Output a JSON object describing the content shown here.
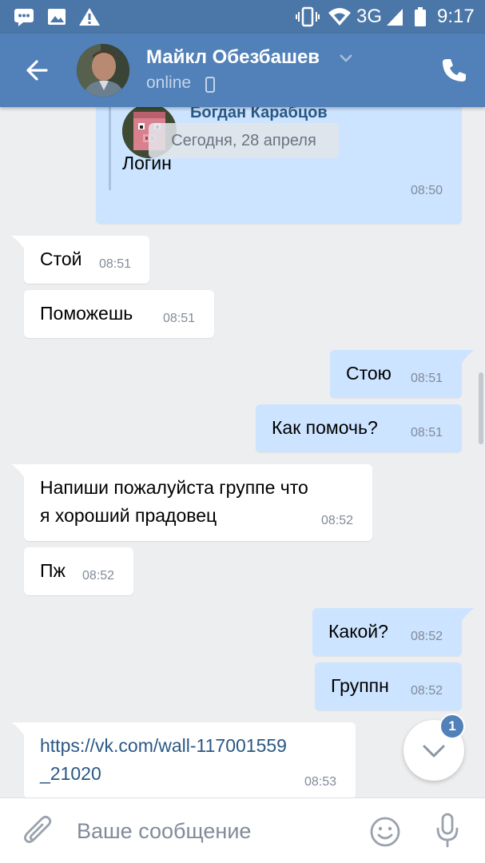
{
  "statusbar": {
    "network": "3G",
    "time": "9:17"
  },
  "header": {
    "contact_name": "Майкл Обезбашев",
    "status": "online"
  },
  "forwarded": {
    "author": "Богдан Карабцов",
    "text": "Логин",
    "time": "08:50",
    "date_pill": "Сегодня, 28 апреля"
  },
  "messages": [
    {
      "dir": "in",
      "text": "Стой",
      "time": "08:51"
    },
    {
      "dir": "in",
      "text": "Поможешь",
      "time": "08:51"
    },
    {
      "dir": "out",
      "text": "Стою",
      "time": "08:51"
    },
    {
      "dir": "out",
      "text": "Как помочь?",
      "time": "08:51"
    },
    {
      "dir": "in",
      "line1": "Напиши пожалуйста группе что",
      "line2": "я хороший прадовец",
      "time": "08:52"
    },
    {
      "dir": "in",
      "text": "Пж",
      "time": "08:52"
    },
    {
      "dir": "out",
      "text": "Какой?",
      "time": "08:52"
    },
    {
      "dir": "out",
      "text": "Группн",
      "time": "08:52"
    },
    {
      "dir": "in",
      "line1": "https://vk.com/wall-117001559",
      "line2": "_21020",
      "time": "08:53"
    }
  ],
  "scroll_button": {
    "badge": "1"
  },
  "composer": {
    "placeholder": "Ваше сообщение"
  },
  "colors": {
    "header": "#5181b8",
    "statusbar": "#4a76a8",
    "outgoing_bubble": "#cce4ff",
    "incoming_bubble": "#ffffff",
    "link": "#2a5885"
  }
}
